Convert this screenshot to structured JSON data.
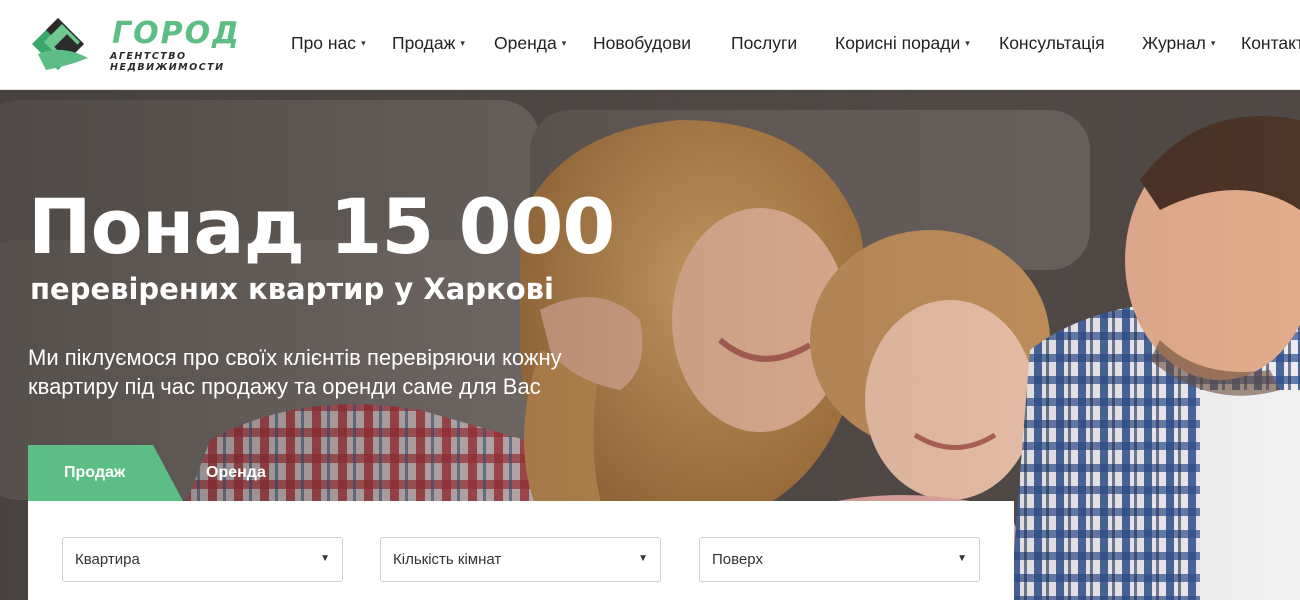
{
  "logo": {
    "name": "ГОРОД",
    "subtitle_line1": "АГЕНТСТВО",
    "subtitle_line2": "НЕДВИЖИМОСТИ"
  },
  "nav": {
    "items": [
      {
        "label": "Про нас",
        "has_dropdown": true
      },
      {
        "label": "Продаж",
        "has_dropdown": true
      },
      {
        "label": "Оренда",
        "has_dropdown": true
      },
      {
        "label": "Новобудови",
        "has_dropdown": false
      },
      {
        "label": "Послуги",
        "has_dropdown": false
      },
      {
        "label": "Корисні поради",
        "has_dropdown": true
      },
      {
        "label": "Консультація",
        "has_dropdown": false
      },
      {
        "label": "Журнал",
        "has_dropdown": true
      },
      {
        "label": "Контакти",
        "has_dropdown": false
      }
    ],
    "caret": "▾"
  },
  "hero": {
    "title": "Понад 15 000",
    "subtitle": "перевірених квартир у Харкові",
    "description": "Ми піклуємося про своїх клієнтів перевіряючи кожну квартиру під час продажу та оренди саме для Вас"
  },
  "search": {
    "tabs": [
      {
        "label": "Продаж",
        "active": true
      },
      {
        "label": "Оренда",
        "active": false
      }
    ],
    "filters": [
      {
        "value": "Квартира"
      },
      {
        "value": "Кількість кімнат"
      },
      {
        "value": "Поверх"
      }
    ],
    "arrow": "▼"
  },
  "colors": {
    "accent_green": "#5cbd85",
    "dark": "#2b2b2b"
  }
}
